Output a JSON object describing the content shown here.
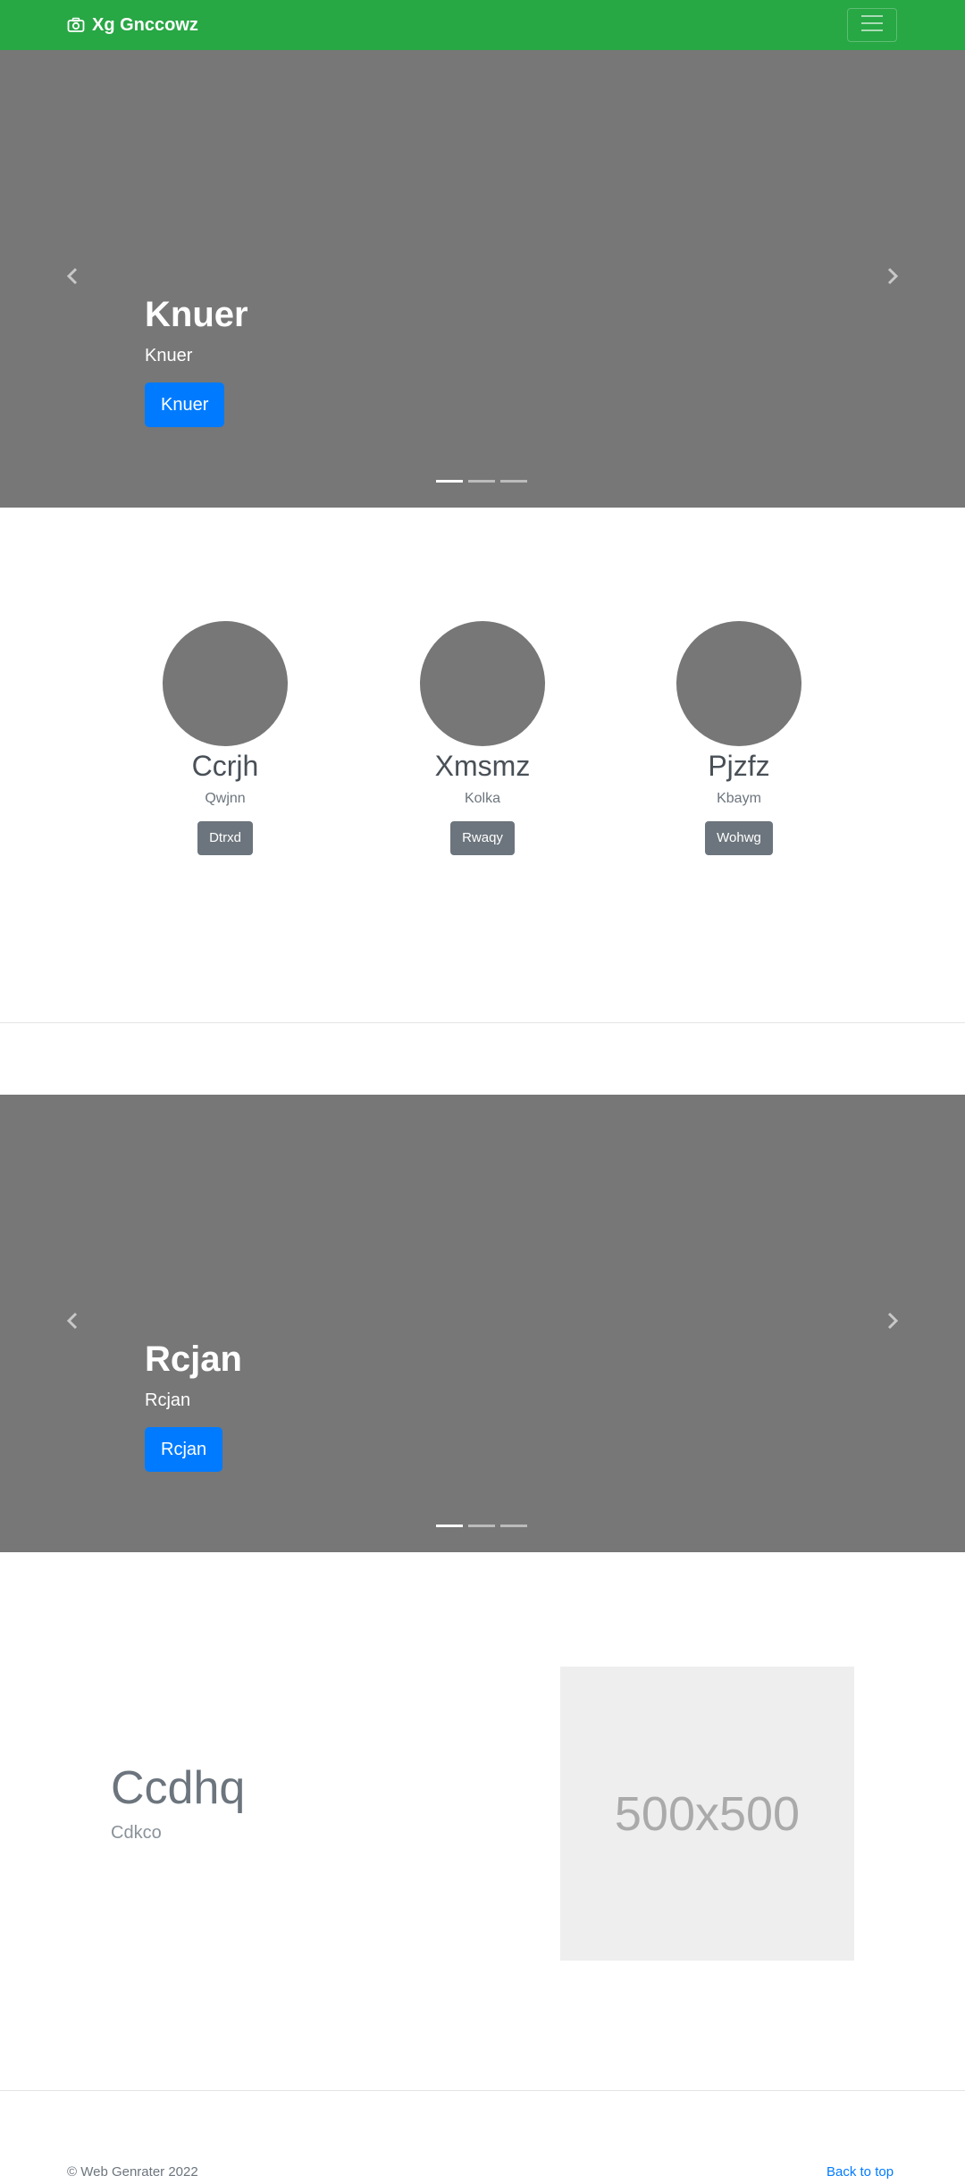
{
  "navbar": {
    "brand": "Xg Gnccowz",
    "brand_icon": "camera-icon",
    "toggler_icon": "hamburger-icon",
    "bg_color": "#28a745"
  },
  "carousel_1": {
    "title": "Knuer",
    "subtitle": "Knuer",
    "button": "Knuer",
    "active_slide": 1,
    "slide_count": 3
  },
  "team": [
    {
      "name": "Ccrjh",
      "role": "Qwjnn",
      "button": "Dtrxd"
    },
    {
      "name": "Xmsmz",
      "role": "Kolka",
      "button": "Rwaqy"
    },
    {
      "name": "Pjzfz",
      "role": "Kbaym",
      "button": "Wohwg"
    }
  ],
  "carousel_2": {
    "title": "Rcjan",
    "subtitle": "Rcjan",
    "button": "Rcjan",
    "active_slide": 1,
    "slide_count": 3
  },
  "featurette": {
    "title": "Ccdhq",
    "subtitle": "Cdkco",
    "image_label": "500x500"
  },
  "footer": {
    "copyright": "© Web Genrater 2022",
    "back_to_top": "Back to top"
  },
  "colors": {
    "primary": "#007bff",
    "secondary": "#6c757d",
    "carousel_bg": "#777777"
  }
}
